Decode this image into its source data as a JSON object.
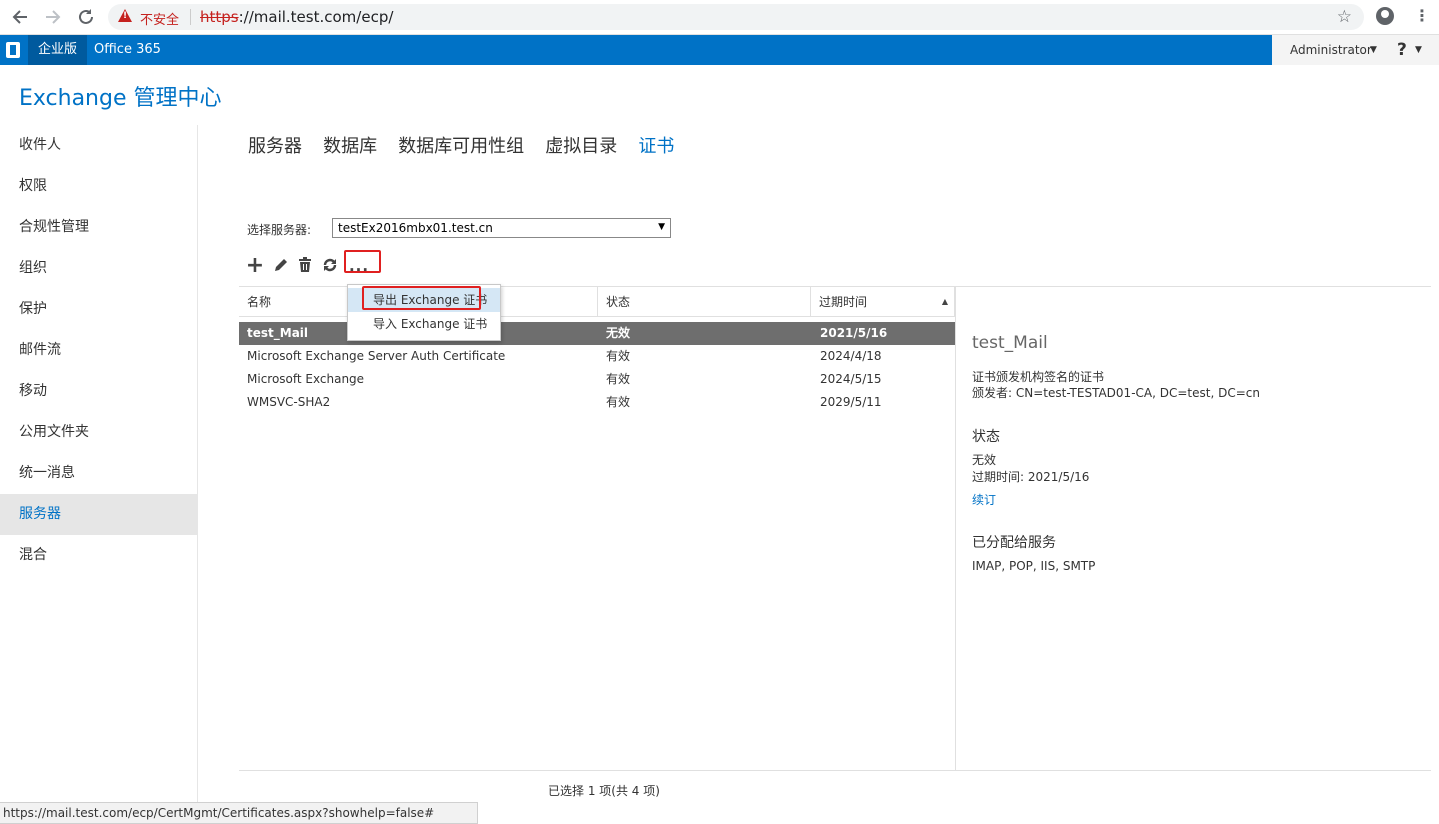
{
  "browser": {
    "insecure_label": "不安全",
    "url_scheme": "https",
    "url_rest": "://mail.test.com/ecp/"
  },
  "o365": {
    "edition": "企业版",
    "label": "Office 365",
    "admin_name": "Administrator",
    "help": "?"
  },
  "app_title": "Exchange 管理中心",
  "leftnav": [
    {
      "label": "收件人"
    },
    {
      "label": "权限"
    },
    {
      "label": "合规性管理"
    },
    {
      "label": "组织"
    },
    {
      "label": "保护"
    },
    {
      "label": "邮件流"
    },
    {
      "label": "移动"
    },
    {
      "label": "公用文件夹"
    },
    {
      "label": "统一消息"
    },
    {
      "label": "服务器"
    },
    {
      "label": "混合"
    }
  ],
  "tabs": [
    {
      "label": "服务器"
    },
    {
      "label": "数据库"
    },
    {
      "label": "数据库可用性组"
    },
    {
      "label": "虚拟目录"
    },
    {
      "label": "证书"
    }
  ],
  "server_select": {
    "label": "选择服务器:",
    "value": "testEx2016mbx01.test.cn"
  },
  "toolbar": {
    "more": "..."
  },
  "grid": {
    "columns": [
      "名称",
      "状态",
      "过期时间"
    ],
    "rows": [
      {
        "name": "test_Mail",
        "status": "无效",
        "expires": "2021/5/16"
      },
      {
        "name": "Microsoft Exchange Server Auth Certificate",
        "status": "有效",
        "expires": "2024/4/18"
      },
      {
        "name": "Microsoft Exchange",
        "status": "有效",
        "expires": "2024/5/15"
      },
      {
        "name": "WMSVC-SHA2",
        "status": "有效",
        "expires": "2029/5/11"
      }
    ],
    "selection_count": "已选择 1 项(共 4 项)"
  },
  "context_menu": [
    {
      "label": "导出 Exchange 证书"
    },
    {
      "label": "导入 Exchange 证书"
    }
  ],
  "detail": {
    "title": "test_Mail",
    "kind": "证书颁发机构签名的证书",
    "issuer": "颁发者: CN=test-TESTAD01-CA, DC=test, DC=cn",
    "status_heading": "状态",
    "status_value": "无效",
    "expires": "过期时间: 2021/5/16",
    "renew": "续订",
    "services_heading": "已分配给服务",
    "services": "IMAP, POP, IIS, SMTP"
  },
  "statusbar": "https://mail.test.com/ecp/CertMgmt/Certificates.aspx?showhelp=false#",
  "colors": {
    "accent": "#0072c6",
    "selected_row": "#6e6e6e",
    "highlight_outline": "#e02020"
  }
}
